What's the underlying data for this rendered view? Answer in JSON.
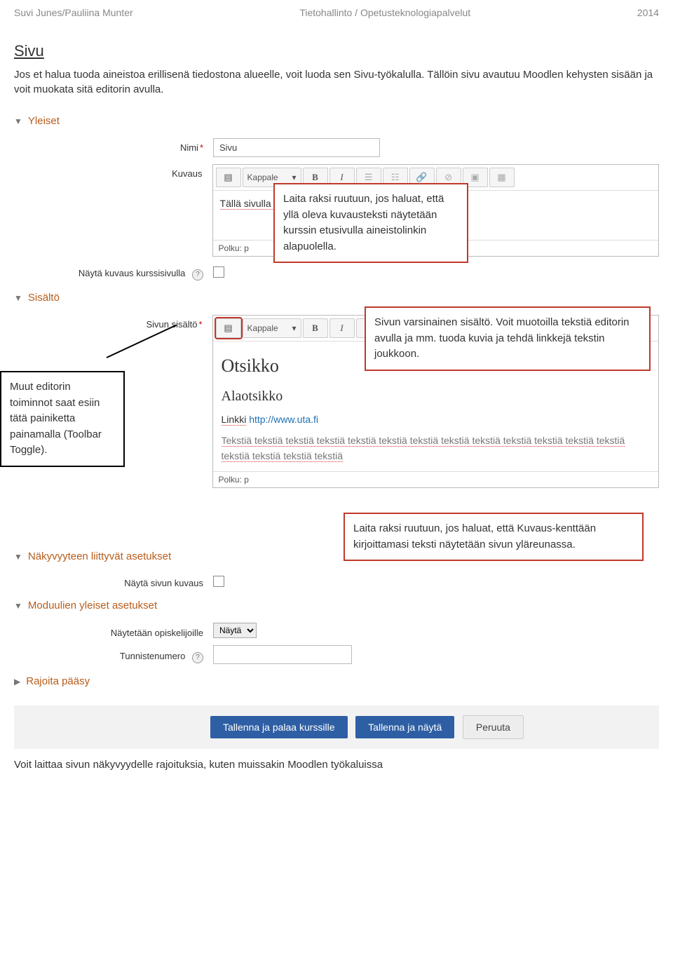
{
  "header": {
    "left": "Suvi Junes/Pauliina Munter",
    "center": "Tietohallinto / Opetusteknologiapalvelut",
    "right": "2014"
  },
  "doc": {
    "heading": "Sivu",
    "paragraph": "Jos et halua tuoda aineistoa erillisenä tiedostona alueelle, voit luoda sen Sivu-työkalulla. Tällöin sivu avautuu Moodlen kehysten sisään ja voit muokata sitä editorin avulla."
  },
  "sections": {
    "general": "Yleiset",
    "content": "Sisältö",
    "appearance": "Näkyvyyteen liittyvät asetukset",
    "common": "Moduulien yleiset asetukset",
    "restrict": "Rajoita pääsy"
  },
  "labels": {
    "name": "Nimi",
    "description": "Kuvaus",
    "path_prefix": "Polku:",
    "path_value": "p",
    "show_desc": "Näytä kuvaus kurssisivulla",
    "page_content": "Sivun sisältö",
    "show_page_desc": "Näytä sivun kuvaus",
    "show_to_students": "Näytetään opiskelijoille",
    "idnumber": "Tunnistenumero",
    "paragraph_style": "Kappale"
  },
  "values": {
    "name_value": "Sivu",
    "desc_text": "Tällä sivulla näet esimerkin sivusta",
    "show_select": "Näytä",
    "rich_h1": "Otsikko",
    "rich_h2": "Alaotsikko",
    "link_label": "Linkki",
    "link_url": "http://www.uta.fi",
    "body_text": "Tekstiä tekstiä tekstiä tekstiä tekstiä tekstiä tekstiä tekstiä tekstiä tekstiä tekstiä tekstiä tekstiä tekstiä tekstiä tekstiä tekstiä"
  },
  "icons": {
    "toggle": "toolbar-toggle-icon",
    "bold": "B",
    "italic": "I",
    "ul": "≣",
    "ol": "≣",
    "link": "🔗",
    "unlink": "⊘",
    "image": "🖼",
    "media": "▦"
  },
  "callouts": {
    "c1": "Laita raksi ruutuun, jos haluat, että yllä oleva kuvausteksti näytetään kurssin etusivulla aineistolinkin alapuolella.",
    "c2": "Sivun varsinainen sisältö. Voit muotoilla tekstiä editorin avulla ja mm. tuoda kuvia ja tehdä linkkejä tekstin joukkoon.",
    "c3": "Muut editorin toiminnot saat esiin tätä painiketta painamalla (Toolbar Toggle).",
    "c4": "Laita raksi ruutuun, jos haluat, että Kuvaus-kenttään kirjoittamasi teksti näytetään sivun yläreunassa."
  },
  "buttons": {
    "save_return": "Tallenna ja palaa kurssille",
    "save_display": "Tallenna ja näytä",
    "cancel": "Peruuta"
  },
  "footer": "Voit laittaa sivun näkyvyydelle rajoituksia, kuten muissakin Moodlen työkaluissa"
}
